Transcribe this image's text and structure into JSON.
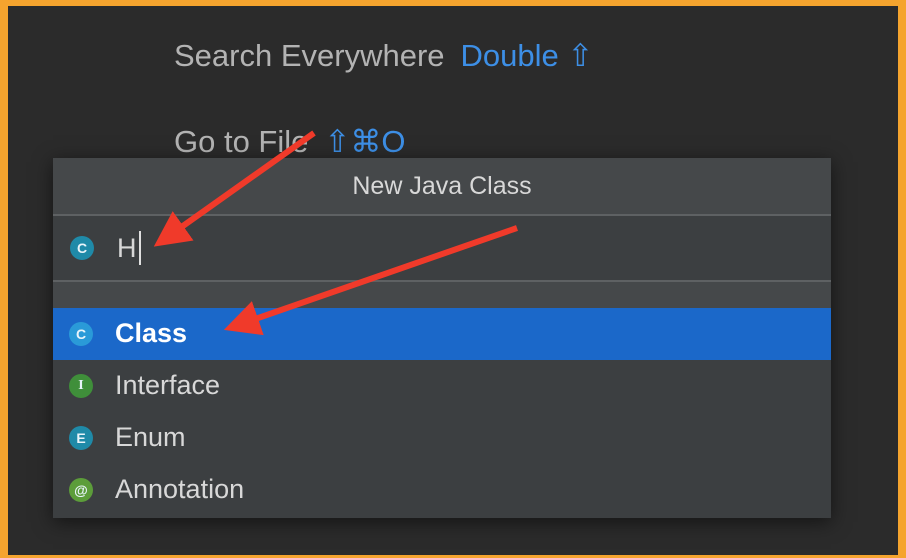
{
  "hints": {
    "search_everywhere": {
      "label": "Search Everywhere",
      "shortcut": "Double ⇧"
    },
    "go_to_file": {
      "label": "Go to File",
      "shortcut": "⇧⌘O"
    }
  },
  "dialog": {
    "title": "New Java Class",
    "name_field": {
      "value": "H",
      "icon": "class-c-icon",
      "icon_letter": "C"
    },
    "kinds": [
      {
        "label": "Class",
        "icon": "class-icon",
        "icon_letter": "C",
        "selected": true
      },
      {
        "label": "Interface",
        "icon": "interface-icon",
        "icon_letter": "I",
        "selected": false
      },
      {
        "label": "Enum",
        "icon": "enum-icon",
        "icon_letter": "E",
        "selected": false
      },
      {
        "label": "Annotation",
        "icon": "annotation-icon",
        "icon_letter": "@",
        "selected": false
      }
    ]
  },
  "colors": {
    "frame_border": "#f5a42e",
    "background": "#2b2b2b",
    "selection": "#1b68c9",
    "shortcut_accent": "#3d8fe6",
    "annotation_arrows": "#f03a2a"
  }
}
